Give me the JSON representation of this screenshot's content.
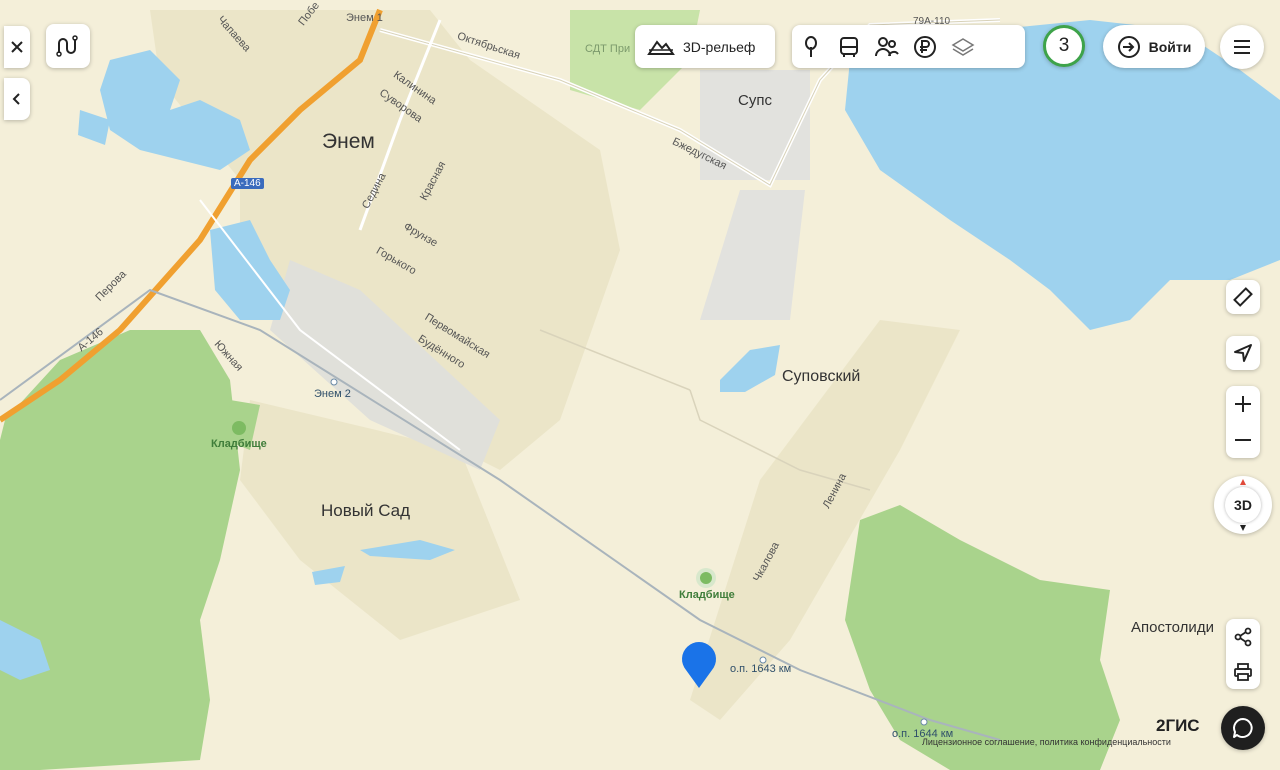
{
  "toolbar": {
    "relief_label": "3D-рельеф",
    "login_label": "Войти",
    "counter": "3"
  },
  "map_labels": {
    "enem": "Энем",
    "enem1": "Энем 1",
    "enem2": "Энем 2",
    "supc": "Супс",
    "suposkiy": "Суповский",
    "noviy_sad": "Новый Сад",
    "apostolidi": "Апостолиди",
    "cemetery1": "Кладбище",
    "cemetery2": "Кладбище",
    "sdt": "СДТ При",
    "op1643": "о.п. 1643 км",
    "op1644": "о.п. 1644 км",
    "road_a146_top": "А-146",
    "road_a146_left": "А-146",
    "road_79a": "79А-110",
    "streets": {
      "oktyabrskaya": "Октябрьская",
      "bzhedugskaya": "Бжедугская",
      "kalinina": "Калинина",
      "suvorova": "Суворова",
      "sedina": "Седина",
      "krasnaya": "Красная",
      "frunze": "Фрунзе",
      "gorkogo": "Горького",
      "pervomayskaya": "Первомайская",
      "budennogo": "Будённого",
      "chapaeva": "Чапаева",
      "pobedy": "Побе",
      "perova": "Перова",
      "yuzhnaya": "Южная",
      "chkalova": "Чкалова",
      "lenina": "Ленина"
    }
  },
  "footer": {
    "brand": "2ГИС",
    "legal": "Лицензионное соглашение, политика конфиденциальности"
  },
  "compass_label": "3D",
  "colors": {
    "water": "#9ed2ee",
    "forest": "#a9d38c",
    "land": "#f4efd9",
    "highway": "#f0a030",
    "accent": "#1a73e8",
    "counter_ring": "#3ea34a"
  },
  "icons": [
    "close-icon",
    "route-icon",
    "chevron-left-icon",
    "relief-icon",
    "attractions-icon",
    "transport-icon",
    "people-icon",
    "ruble-icon",
    "layers-icon",
    "login-icon",
    "menu-icon",
    "ruler-icon",
    "locate-icon",
    "zoom-in-icon",
    "zoom-out-icon",
    "share-icon",
    "print-icon",
    "chat-icon",
    "location-pin-icon"
  ]
}
